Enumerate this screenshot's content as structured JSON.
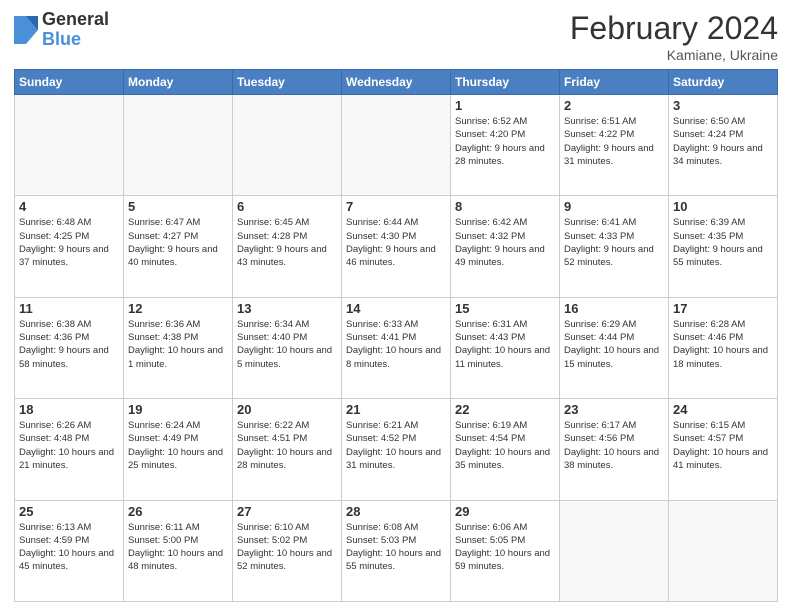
{
  "header": {
    "logo_general": "General",
    "logo_blue": "Blue",
    "title": "February 2024",
    "location": "Kamiane, Ukraine"
  },
  "days_of_week": [
    "Sunday",
    "Monday",
    "Tuesday",
    "Wednesday",
    "Thursday",
    "Friday",
    "Saturday"
  ],
  "weeks": [
    [
      {
        "day": "",
        "info": ""
      },
      {
        "day": "",
        "info": ""
      },
      {
        "day": "",
        "info": ""
      },
      {
        "day": "",
        "info": ""
      },
      {
        "day": "1",
        "info": "Sunrise: 6:52 AM\nSunset: 4:20 PM\nDaylight: 9 hours\nand 28 minutes."
      },
      {
        "day": "2",
        "info": "Sunrise: 6:51 AM\nSunset: 4:22 PM\nDaylight: 9 hours\nand 31 minutes."
      },
      {
        "day": "3",
        "info": "Sunrise: 6:50 AM\nSunset: 4:24 PM\nDaylight: 9 hours\nand 34 minutes."
      }
    ],
    [
      {
        "day": "4",
        "info": "Sunrise: 6:48 AM\nSunset: 4:25 PM\nDaylight: 9 hours\nand 37 minutes."
      },
      {
        "day": "5",
        "info": "Sunrise: 6:47 AM\nSunset: 4:27 PM\nDaylight: 9 hours\nand 40 minutes."
      },
      {
        "day": "6",
        "info": "Sunrise: 6:45 AM\nSunset: 4:28 PM\nDaylight: 9 hours\nand 43 minutes."
      },
      {
        "day": "7",
        "info": "Sunrise: 6:44 AM\nSunset: 4:30 PM\nDaylight: 9 hours\nand 46 minutes."
      },
      {
        "day": "8",
        "info": "Sunrise: 6:42 AM\nSunset: 4:32 PM\nDaylight: 9 hours\nand 49 minutes."
      },
      {
        "day": "9",
        "info": "Sunrise: 6:41 AM\nSunset: 4:33 PM\nDaylight: 9 hours\nand 52 minutes."
      },
      {
        "day": "10",
        "info": "Sunrise: 6:39 AM\nSunset: 4:35 PM\nDaylight: 9 hours\nand 55 minutes."
      }
    ],
    [
      {
        "day": "11",
        "info": "Sunrise: 6:38 AM\nSunset: 4:36 PM\nDaylight: 9 hours\nand 58 minutes."
      },
      {
        "day": "12",
        "info": "Sunrise: 6:36 AM\nSunset: 4:38 PM\nDaylight: 10 hours\nand 1 minute."
      },
      {
        "day": "13",
        "info": "Sunrise: 6:34 AM\nSunset: 4:40 PM\nDaylight: 10 hours\nand 5 minutes."
      },
      {
        "day": "14",
        "info": "Sunrise: 6:33 AM\nSunset: 4:41 PM\nDaylight: 10 hours\nand 8 minutes."
      },
      {
        "day": "15",
        "info": "Sunrise: 6:31 AM\nSunset: 4:43 PM\nDaylight: 10 hours\nand 11 minutes."
      },
      {
        "day": "16",
        "info": "Sunrise: 6:29 AM\nSunset: 4:44 PM\nDaylight: 10 hours\nand 15 minutes."
      },
      {
        "day": "17",
        "info": "Sunrise: 6:28 AM\nSunset: 4:46 PM\nDaylight: 10 hours\nand 18 minutes."
      }
    ],
    [
      {
        "day": "18",
        "info": "Sunrise: 6:26 AM\nSunset: 4:48 PM\nDaylight: 10 hours\nand 21 minutes."
      },
      {
        "day": "19",
        "info": "Sunrise: 6:24 AM\nSunset: 4:49 PM\nDaylight: 10 hours\nand 25 minutes."
      },
      {
        "day": "20",
        "info": "Sunrise: 6:22 AM\nSunset: 4:51 PM\nDaylight: 10 hours\nand 28 minutes."
      },
      {
        "day": "21",
        "info": "Sunrise: 6:21 AM\nSunset: 4:52 PM\nDaylight: 10 hours\nand 31 minutes."
      },
      {
        "day": "22",
        "info": "Sunrise: 6:19 AM\nSunset: 4:54 PM\nDaylight: 10 hours\nand 35 minutes."
      },
      {
        "day": "23",
        "info": "Sunrise: 6:17 AM\nSunset: 4:56 PM\nDaylight: 10 hours\nand 38 minutes."
      },
      {
        "day": "24",
        "info": "Sunrise: 6:15 AM\nSunset: 4:57 PM\nDaylight: 10 hours\nand 41 minutes."
      }
    ],
    [
      {
        "day": "25",
        "info": "Sunrise: 6:13 AM\nSunset: 4:59 PM\nDaylight: 10 hours\nand 45 minutes."
      },
      {
        "day": "26",
        "info": "Sunrise: 6:11 AM\nSunset: 5:00 PM\nDaylight: 10 hours\nand 48 minutes."
      },
      {
        "day": "27",
        "info": "Sunrise: 6:10 AM\nSunset: 5:02 PM\nDaylight: 10 hours\nand 52 minutes."
      },
      {
        "day": "28",
        "info": "Sunrise: 6:08 AM\nSunset: 5:03 PM\nDaylight: 10 hours\nand 55 minutes."
      },
      {
        "day": "29",
        "info": "Sunrise: 6:06 AM\nSunset: 5:05 PM\nDaylight: 10 hours\nand 59 minutes."
      },
      {
        "day": "",
        "info": ""
      },
      {
        "day": "",
        "info": ""
      }
    ]
  ]
}
